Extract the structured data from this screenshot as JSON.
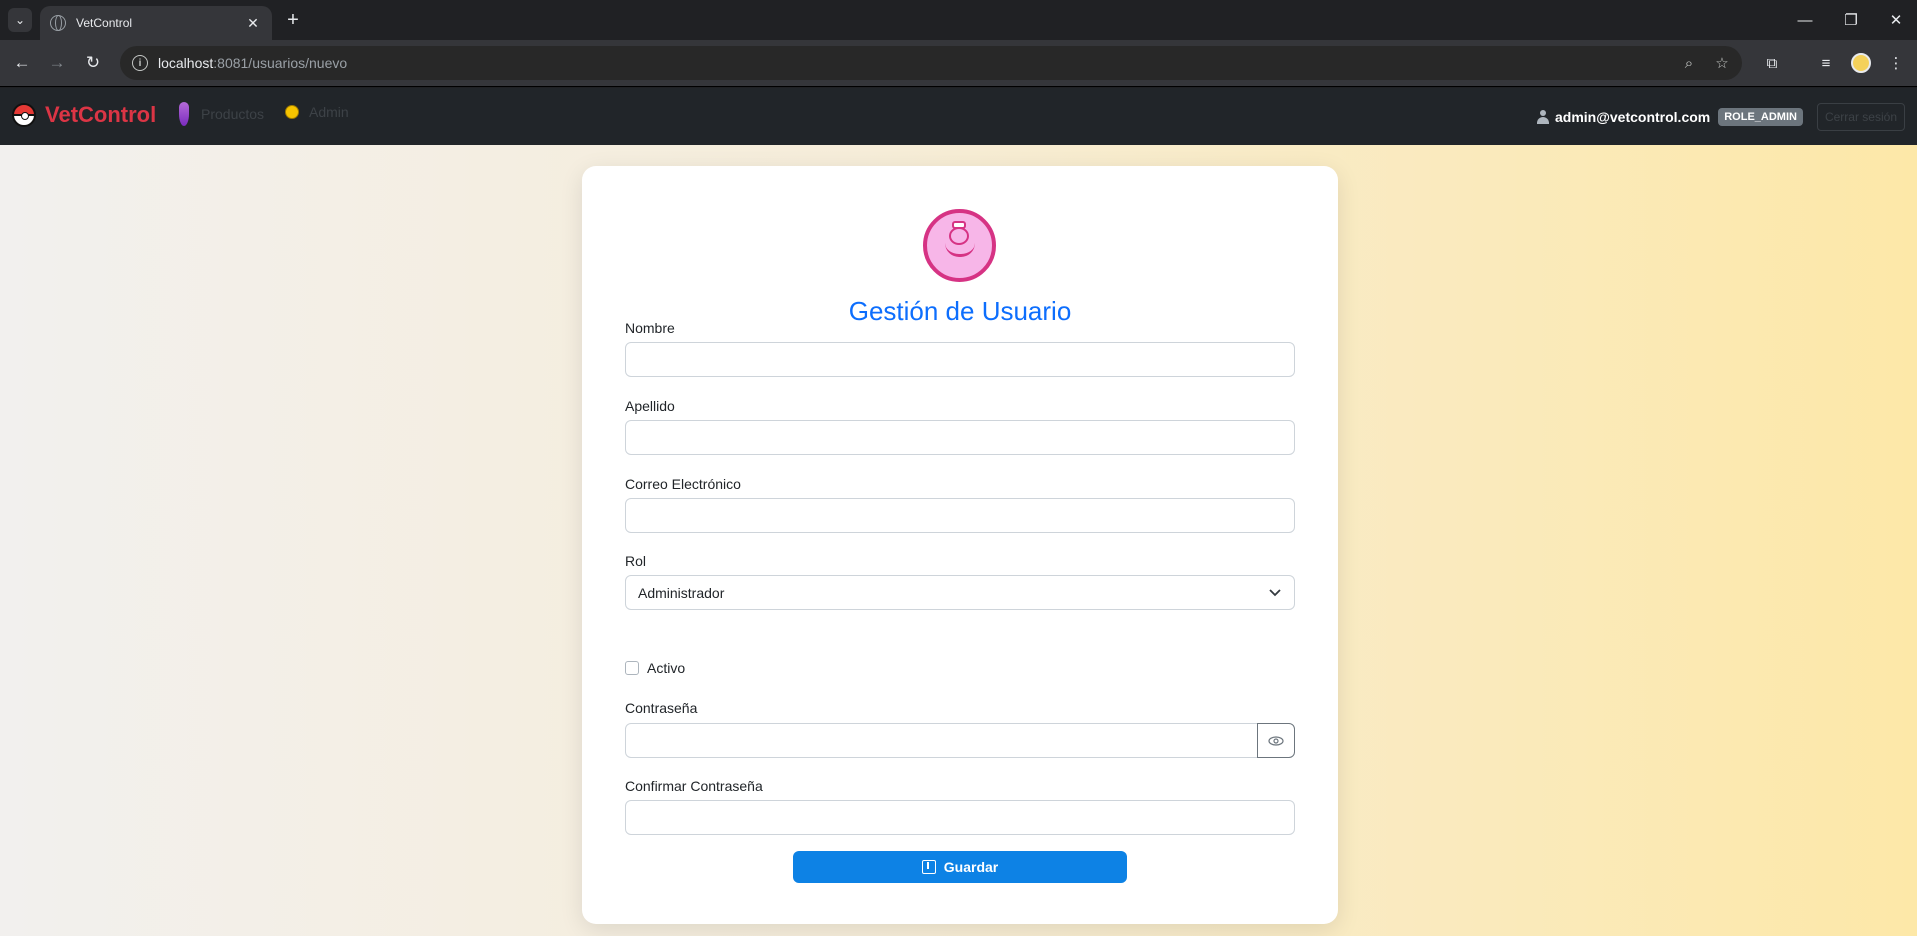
{
  "browser": {
    "tab_title": "VetControl",
    "url_host": "localhost",
    "url_rest": ":8081/usuarios/nuevo",
    "new_tab_glyph": "+",
    "close_glyph": "✕"
  },
  "navbar": {
    "brand": "VetControl",
    "links": [
      {
        "label": "Productos",
        "icon": "potion-icon"
      },
      {
        "label": "Admin",
        "icon": "face-icon"
      }
    ],
    "user_email": "admin@vetcontrol.com",
    "role": "ROLE_ADMIN",
    "logout_label": "Cerrar sesión"
  },
  "form": {
    "title": "Gestión de Usuario",
    "nombre_label": "Nombre",
    "nombre_value": "",
    "apellido_label": "Apellido",
    "apellido_value": "",
    "correo_label": "Correo Electrónico",
    "correo_value": "",
    "rol_label": "Rol",
    "rol_value": "Administrador",
    "activo_label": "Activo",
    "activo_checked": false,
    "password_label": "Contraseña",
    "password_value": "",
    "confirm_label": "Confirmar Contraseña",
    "confirm_value": "",
    "save_label": "Guardar"
  },
  "colors": {
    "primary": "#0d6efd",
    "brand": "#dc3545",
    "navbar_bg": "#212529",
    "avatar_pink": "#d63384"
  }
}
